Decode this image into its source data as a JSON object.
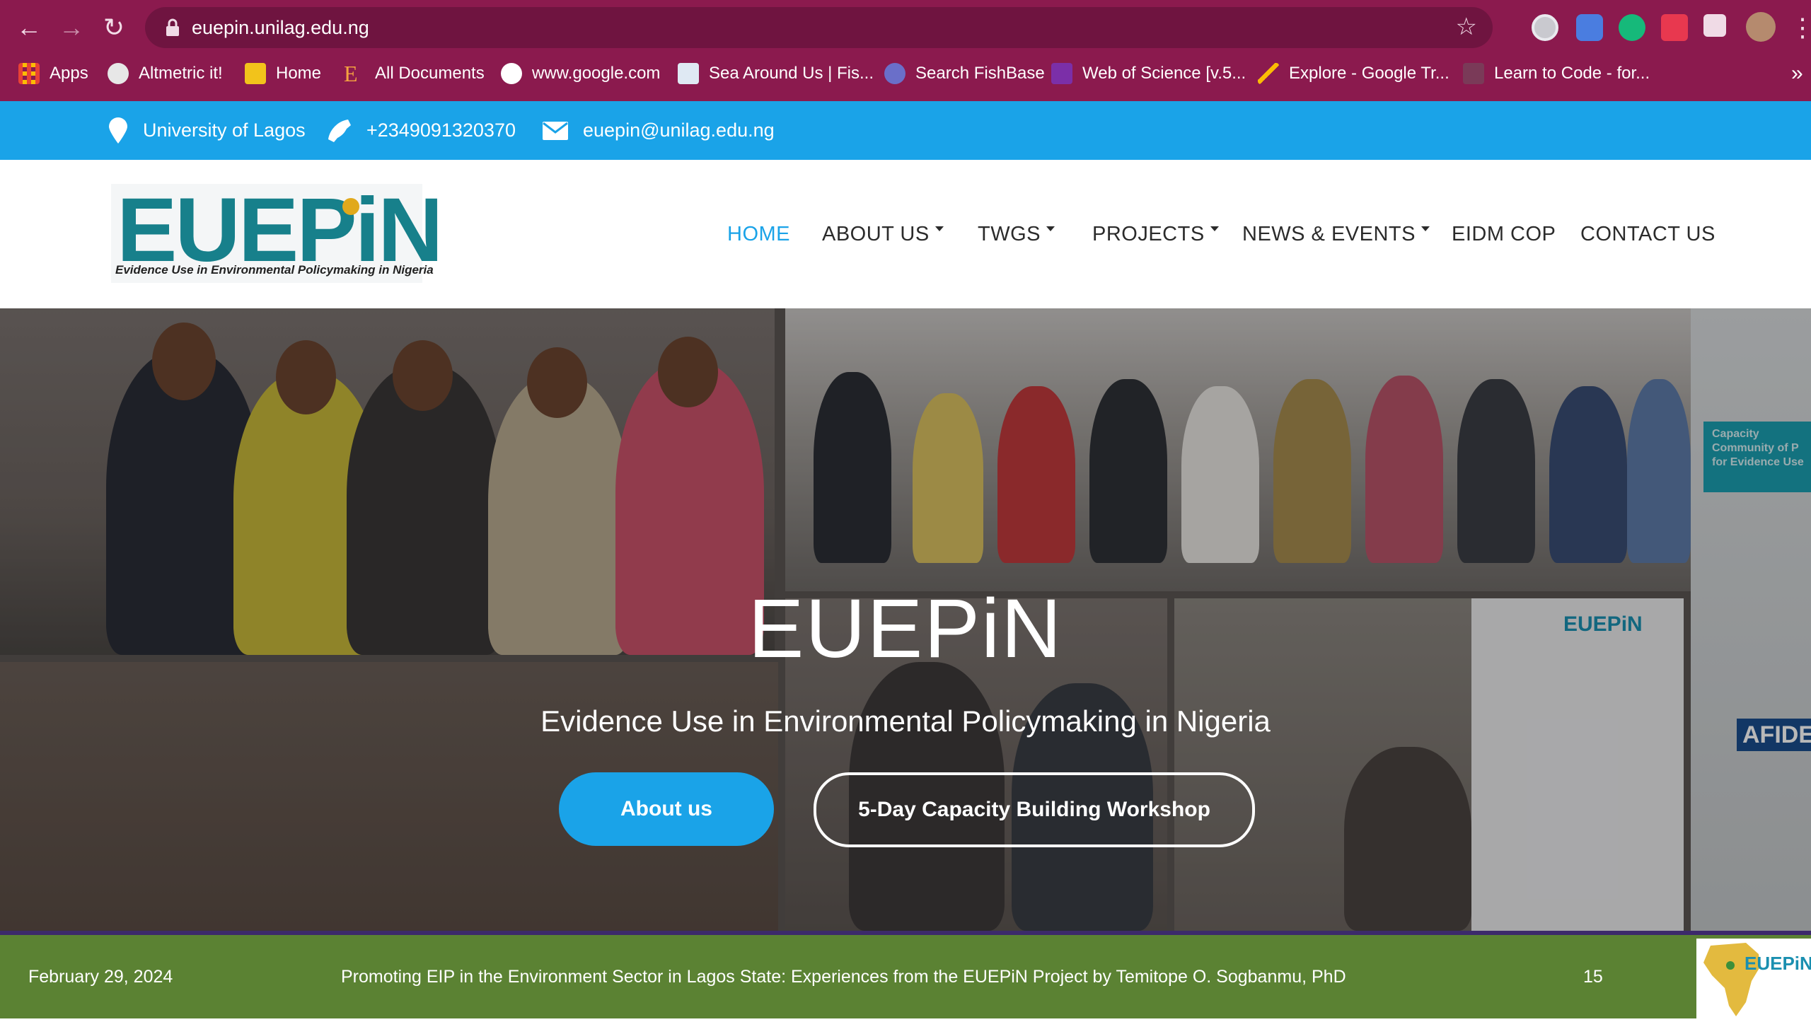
{
  "browser": {
    "url": "euepin.unilag.edu.ng",
    "bookmarks": [
      {
        "label": "Apps",
        "icon": "apps-grid-icon"
      },
      {
        "label": "Altmetric it!",
        "icon": "altmetric-icon"
      },
      {
        "label": "Home",
        "icon": "home-bookmark-icon"
      },
      {
        "label": "All Documents",
        "icon": "documents-icon"
      },
      {
        "label": "www.google.com",
        "icon": "google-icon"
      },
      {
        "label": "Sea Around Us | Fis...",
        "icon": "sea-around-us-icon"
      },
      {
        "label": "Search FishBase",
        "icon": "fishbase-icon"
      },
      {
        "label": "Web of Science [v.5...",
        "icon": "web-of-science-icon"
      },
      {
        "label": "Explore - Google Tr...",
        "icon": "google-trends-icon"
      },
      {
        "label": "Learn to Code - for...",
        "icon": "learn-to-code-icon"
      }
    ],
    "overflow_label": "»"
  },
  "topbar": {
    "location": "University of Lagos",
    "phone": "+2349091320370",
    "email": "euepin@unilag.edu.ng"
  },
  "header": {
    "logo_text": "EUEPiN",
    "logo_tagline": "Evidence Use in Environmental Policymaking in Nigeria",
    "nav": [
      {
        "label": "HOME",
        "active": true,
        "dropdown": false
      },
      {
        "label": "ABOUT US",
        "active": false,
        "dropdown": true
      },
      {
        "label": "TWGS",
        "active": false,
        "dropdown": true
      },
      {
        "label": "PROJECTS",
        "active": false,
        "dropdown": true
      },
      {
        "label": "NEWS & EVENTS",
        "active": false,
        "dropdown": true
      },
      {
        "label": "EIDM COP",
        "active": false,
        "dropdown": false
      },
      {
        "label": "CONTACT US",
        "active": false,
        "dropdown": false
      }
    ]
  },
  "hero": {
    "title": "EUEPiN",
    "subtitle": "Evidence Use in Environmental Policymaking in Nigeria",
    "primary_button": "About us",
    "secondary_button": "5-Day Capacity Building Workshop",
    "banner_text": "Capacity Community of P for Evidence Use",
    "rollup_title": "EUEPiN",
    "afidep": "AFIDE"
  },
  "footer": {
    "date": "February 29, 2024",
    "caption": "Promoting EIP in the Environment Sector in Lagos State:  Experiences from the EUEPiN Project by Temitope O. Sogbanmu, PhD",
    "page_number": "15",
    "logo_text": "EUEPiN"
  },
  "colors": {
    "chrome": "#8b1a4e",
    "infobar": "#1aa3e8",
    "accent": "#1aa3e8",
    "logo_teal": "#17808b",
    "footer": "#5b8233"
  }
}
